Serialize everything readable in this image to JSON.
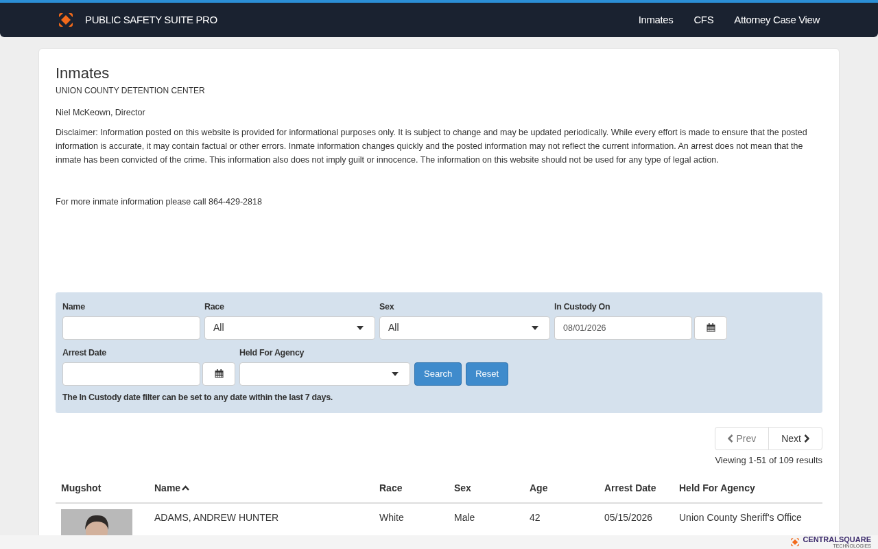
{
  "navbar": {
    "brand": "PUBLIC SAFETY SUITE PRO",
    "links": [
      {
        "label": "Inmates"
      },
      {
        "label": "CFS"
      },
      {
        "label": "Attorney Case View"
      }
    ]
  },
  "page": {
    "title": "Inmates",
    "facility": "UNION COUNTY DETENTION CENTER",
    "director": "Niel McKeown, Director",
    "disclaimer": "Disclaimer: Information posted on this website is provided for informational purposes only. It is subject to change and may be updated periodically. While every effort is made to ensure that the posted information is accurate, it may contain factual or other errors. Inmate information changes quickly and the posted information may not reflect the current information. An arrest does not mean that the inmate has been convicted of the crime. This information also does not imply guilt or innocence.  The information on this website should not be used for any type of legal action.",
    "phone_note": "For more inmate information please call 864-429-2818"
  },
  "filters": {
    "rows": [
      [
        {
          "kind": "text",
          "label": "Name"
        },
        {
          "kind": "select",
          "label": "Race",
          "value": "All"
        },
        {
          "kind": "select",
          "label": "Sex",
          "value": "All"
        },
        {
          "kind": "date",
          "label": "In Custody On",
          "value": "08/01/2026"
        }
      ],
      [
        {
          "kind": "date",
          "label": "Arrest Date"
        },
        {
          "kind": "select",
          "label": "Held For Agency"
        }
      ]
    ],
    "buttons": [
      {
        "label": "Search"
      },
      {
        "label": "Reset"
      }
    ],
    "note": "The In Custody date filter can be set to any date within the last 7 days."
  },
  "pagination": {
    "prev": {
      "label": "Prev",
      "disabled": true
    },
    "next": {
      "label": "Next",
      "disabled": false
    },
    "summary": "Viewing 1-51 of 109 results"
  },
  "table": {
    "columns": [
      {
        "label": "Mugshot",
        "sorted": false
      },
      {
        "label": "Name",
        "sorted": true
      },
      {
        "label": "Race",
        "sorted": false
      },
      {
        "label": "Sex",
        "sorted": false
      },
      {
        "label": "Age",
        "sorted": false
      },
      {
        "label": "Arrest Date",
        "sorted": false
      },
      {
        "label": "Held For Agency",
        "sorted": false
      }
    ],
    "rows": [
      {
        "cells": [
          {
            "kind": "picture"
          },
          "ADAMS, ANDREW HUNTER",
          "White",
          "Male",
          "42",
          "05/15/2026",
          "Union County Sheriff's Office"
        ]
      }
    ]
  },
  "footer": {
    "brand": "CENTRALSQUARE",
    "tagline": "TECHNOLOGIES"
  }
}
